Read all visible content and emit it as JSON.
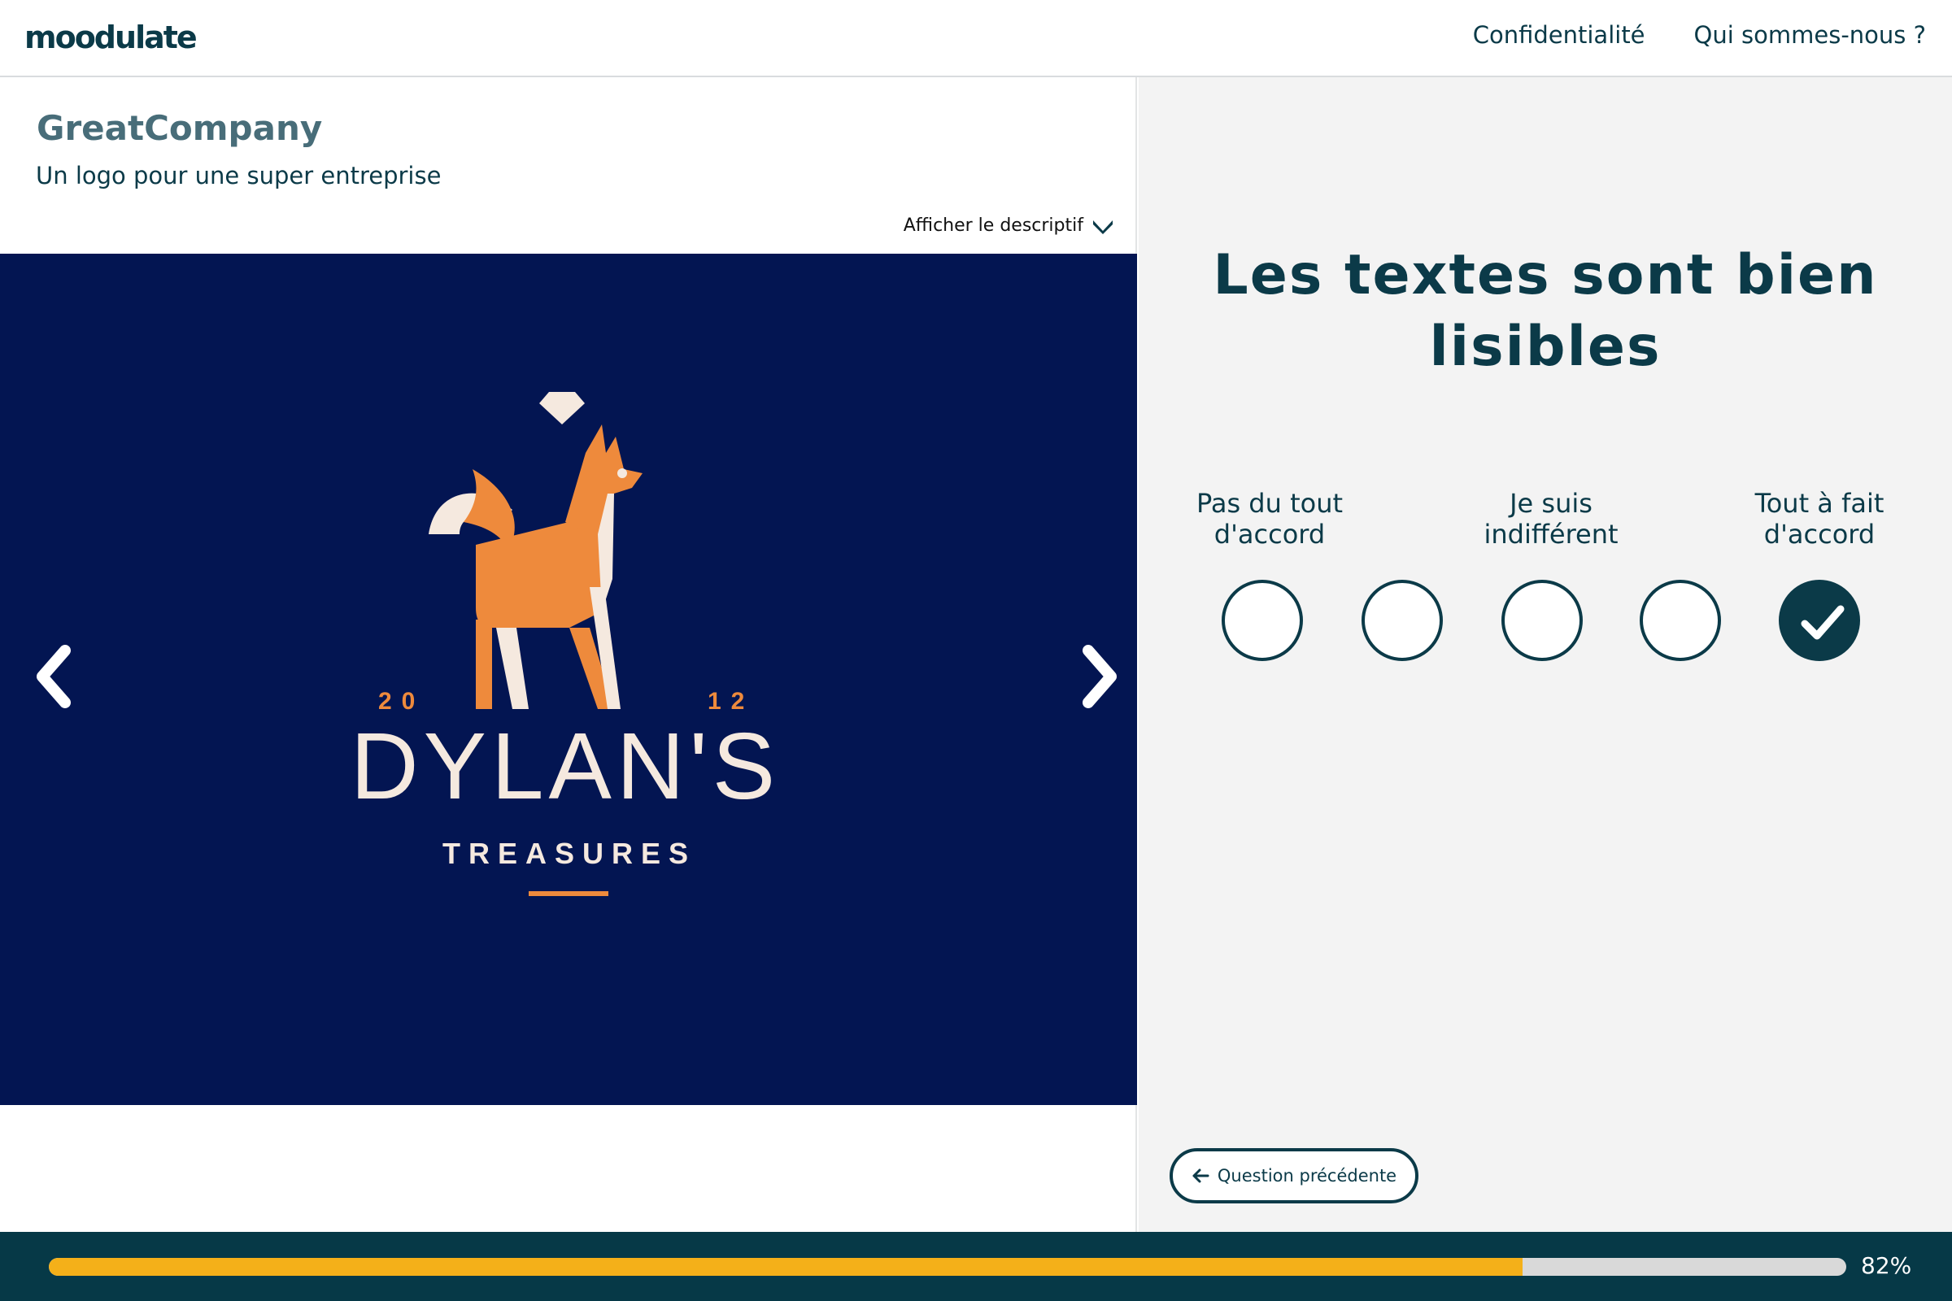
{
  "header": {
    "logo_text": "moodulate",
    "nav": [
      {
        "label": "Confidentialité"
      },
      {
        "label": "Qui sommes-nous ?"
      }
    ]
  },
  "project": {
    "company": "GreatCompany",
    "tagline": "Un logo pour une super entreprise",
    "description_toggle": "Afficher le descriptif",
    "toggle_icon": "chevron-down-icon"
  },
  "viewer": {
    "background_color": "#031552",
    "prev_icon": "chevron-left-icon",
    "next_icon": "chevron-right-icon",
    "logo_art": {
      "year_left": "20",
      "year_right": "12",
      "brand": "DYLAN'S",
      "sub": "TREASURES",
      "accent_color": "#ee8a3c",
      "cream_color": "#f5e9df"
    }
  },
  "question": {
    "text": "Les textes sont bien lisibles",
    "scale_labels": {
      "left": "Pas du tout d'accord",
      "middle": "Je suis indifférent",
      "right": "Tout à fait d'accord"
    },
    "options": [
      {
        "value": 1,
        "selected": false
      },
      {
        "value": 2,
        "selected": false
      },
      {
        "value": 3,
        "selected": false
      },
      {
        "value": 4,
        "selected": false
      },
      {
        "value": 5,
        "selected": true
      }
    ],
    "selected_icon": "check-icon",
    "previous_button": "Question précédente",
    "previous_icon": "arrow-left-icon"
  },
  "progress": {
    "value": 0.82,
    "label": "82%",
    "bar_color": "#f4b019",
    "track_color": "#d9d9d9"
  },
  "colors": {
    "primary": "#0b3a48",
    "footer_bg": "#063947",
    "panel_bg": "#f3f3f3"
  }
}
